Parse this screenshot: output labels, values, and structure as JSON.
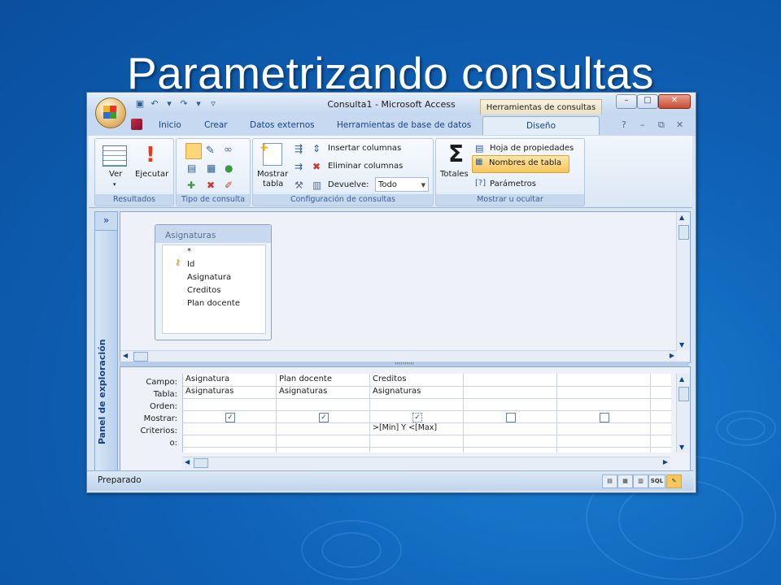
{
  "slide": {
    "title": "Parametrizando consultas"
  },
  "window": {
    "title": "Consulta1 - Microsoft Access",
    "contextual_tab": "Herramientas de consultas",
    "controls": {
      "minimize": "–",
      "maximize": "□",
      "close": "✕"
    }
  },
  "ribbon_tabs": [
    "Inicio",
    "Crear",
    "Datos externos",
    "Herramientas de base de datos",
    "Diseño"
  ],
  "ribbon_right": {
    "help": "?",
    "minimize": "–",
    "restore": "⧉",
    "close": "✕"
  },
  "groups": {
    "resultados": {
      "label": "Resultados",
      "ver": "Ver",
      "ejecutar": "Ejecutar"
    },
    "tipo": {
      "label": "Tipo de consulta"
    },
    "config": {
      "label": "Configuración de consultas",
      "mostrar_tabla_1": "Mostrar",
      "mostrar_tabla_2": "tabla",
      "insertar": "Insertar columnas",
      "eliminar": "Eliminar columnas",
      "devuelve": "Devuelve:",
      "devuelve_value": "Todo"
    },
    "mostrar": {
      "label": "Mostrar u ocultar",
      "totales": "Totales",
      "hoja": "Hoja de propiedades",
      "nombres": "Nombres de tabla",
      "parametros": "Parámetros"
    }
  },
  "nav_pane": {
    "label": "Panel de exploración",
    "toggle": "»"
  },
  "table_box": {
    "title": "Asignaturas",
    "fields": [
      "*",
      "Id",
      "Asignatura",
      "Creditos",
      "Plan docente"
    ]
  },
  "grid": {
    "row_labels": [
      "Campo:",
      "Tabla:",
      "Orden:",
      "Mostrar:",
      "Criterios:",
      "o:"
    ],
    "columns": [
      {
        "campo": "Asignatura",
        "tabla": "Asignaturas",
        "mostrar": true,
        "criterios": ""
      },
      {
        "campo": "Plan docente",
        "tabla": "Asignaturas",
        "mostrar": true,
        "criterios": ""
      },
      {
        "campo": "Creditos",
        "tabla": "Asignaturas",
        "mostrar": true,
        "criterios": ">[Min] Y <[Max]"
      },
      {
        "campo": "",
        "tabla": "",
        "mostrar": false,
        "criterios": ""
      },
      {
        "campo": "",
        "tabla": "",
        "mostrar": false,
        "criterios": ""
      }
    ]
  },
  "status": {
    "text": "Preparado",
    "sql": "SQL"
  }
}
